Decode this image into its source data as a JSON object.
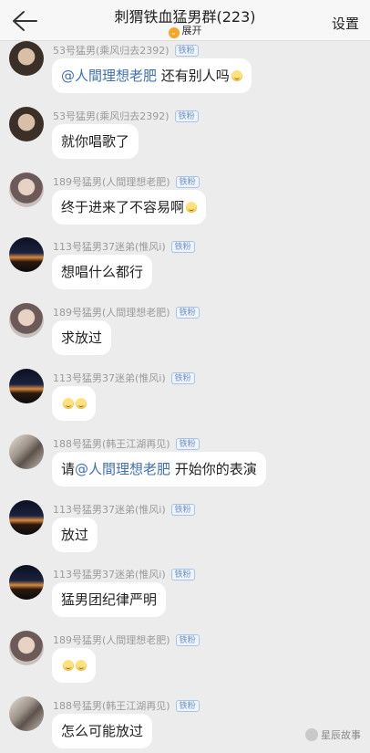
{
  "header": {
    "title": "刺猬铁血猛男群(223)",
    "expand_label": "展开",
    "settings_label": "设置",
    "back_icon": "back-arrow-icon"
  },
  "messages": [
    {
      "sender": "53号猛男(乘风归去2392)",
      "badge": "铁粉",
      "avatar": "avatar-a",
      "mention": "@人間理想老肥",
      "text_after": " 还有别人吗",
      "emoji": 1
    },
    {
      "sender": "53号猛男(乘风归去2392)",
      "badge": "铁粉",
      "avatar": "avatar-a",
      "text": "就你唱歌了"
    },
    {
      "sender": "189号猛男(人間理想老肥)",
      "badge": "铁粉",
      "avatar": "avatar-b",
      "text": "终于进来了不容易啊",
      "emoji": 1
    },
    {
      "sender": "113号猛男37迷弟(惟风i)",
      "badge": "铁粉",
      "avatar": "avatar-c",
      "text": "想唱什么都行"
    },
    {
      "sender": "189号猛男(人間理想老肥)",
      "badge": "铁粉",
      "avatar": "avatar-b",
      "text": "求放过"
    },
    {
      "sender": "113号猛男37迷弟(惟风i)",
      "badge": "铁粉",
      "avatar": "avatar-c",
      "emoji_only": 2
    },
    {
      "sender": "188号猛男(韩王江湖再见)",
      "badge": "铁粉",
      "avatar": "avatar-d",
      "text_before": "请",
      "mention": "@人間理想老肥",
      "text_after": " 开始你的表演"
    },
    {
      "sender": "113号猛男37迷弟(惟风i)",
      "badge": "铁粉",
      "avatar": "avatar-c",
      "text": "放过"
    },
    {
      "sender": "113号猛男37迷弟(惟风i)",
      "badge": "铁粉",
      "avatar": "avatar-c",
      "text": "猛男团纪律严明"
    },
    {
      "sender": "189号猛男(人間理想老肥)",
      "badge": "铁粉",
      "avatar": "avatar-b",
      "emoji_only": 2
    },
    {
      "sender": "188号猛男(韩王江湖再见)",
      "badge": "铁粉",
      "avatar": "avatar-d",
      "text": "怎么可能放过"
    }
  ],
  "watermark": "星辰故事"
}
